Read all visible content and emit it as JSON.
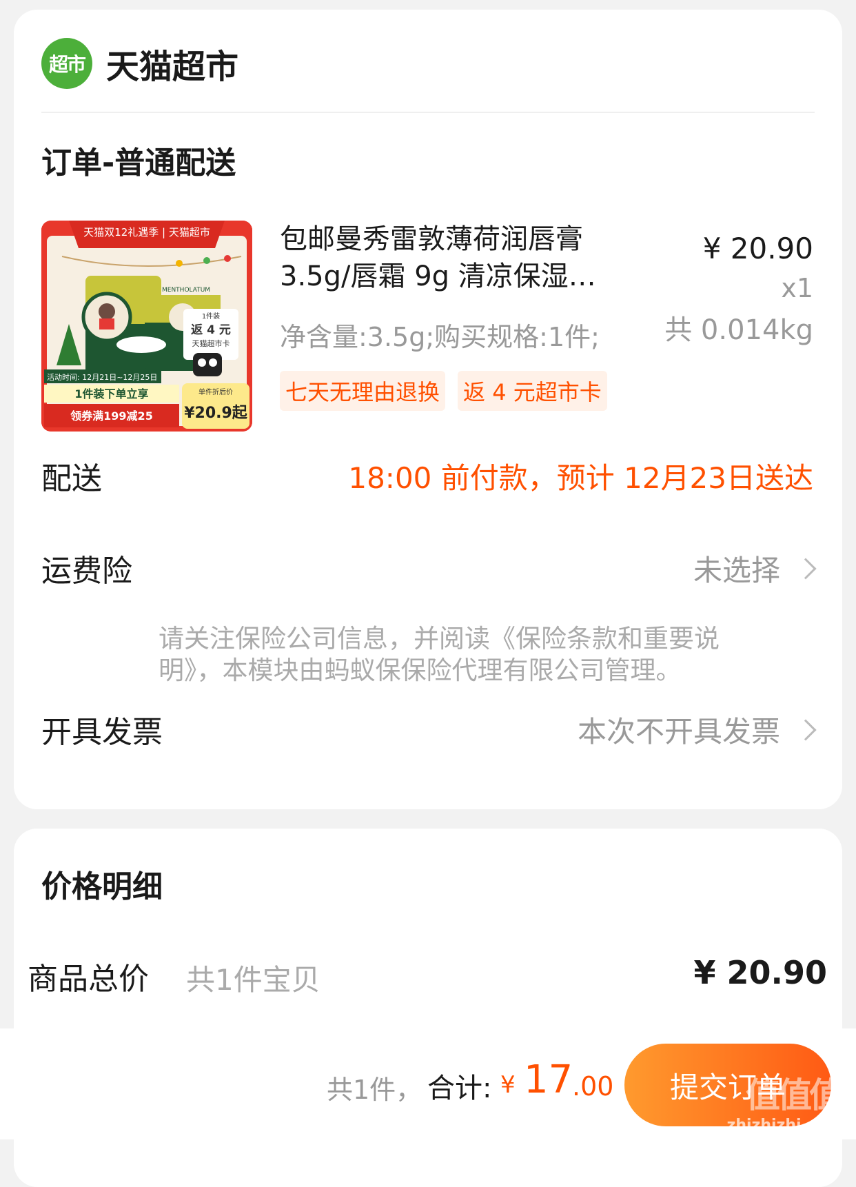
{
  "store": {
    "logo_text": "超市",
    "name": "天猫超市"
  },
  "order": {
    "section_title": "订单-普通配送",
    "product": {
      "title_line1": "包邮曼秀雷敦薄荷润唇膏",
      "title_line2": "3.5g/唇霜 9g 清凉保湿…",
      "spec": "净含量:3.5g;购买规格:1件;",
      "price": "¥ 20.90",
      "qty": "x1",
      "weight": "共 0.014kg",
      "tags": [
        "七天无理由退换",
        "返 4 元超市卡"
      ],
      "thumbnail": {
        "banner": "天猫双12礼遇季 | 天猫超市",
        "brand": "MENTHOLATUM",
        "promo_pack": "1件装",
        "promo_return": "返 4 元",
        "promo_card": "天猫超市卡",
        "activity_time": "活动时间: 12月21日~12月25日",
        "promo_line1": "1件装下单立享",
        "promo_line2": "领券满199减25",
        "after_price_label": "单件折后价",
        "after_price": "¥20.9起"
      }
    },
    "delivery": {
      "label": "配送",
      "value": "18:00 前付款，预计 12月23日送达"
    },
    "insurance": {
      "label": "运费险",
      "value": "未选择",
      "note": "请关注保险公司信息，并阅读《保险条款和重要说明》，本模块由蚂蚁保保险代理有限公司管理。"
    },
    "invoice": {
      "label": "开具发票",
      "value": "本次不开具发票"
    }
  },
  "price_detail": {
    "title": "价格明细",
    "goods_total_label": "商品总价",
    "goods_total_sub": "共1件宝贝",
    "goods_total_value": "¥ 20.90"
  },
  "bottom_bar": {
    "count": "共1件，",
    "total_label": "合计:",
    "currency": "¥",
    "amount_int": "17",
    "amount_dec": ".00",
    "submit_label": "提交订单"
  },
  "watermark": {
    "text": "值值值",
    "domain": "zhizhizhi.com"
  },
  "colors": {
    "accent": "#ff5000",
    "brand_green": "#4caf3a",
    "card_bg": "#ffffff",
    "page_bg": "#f2f2f2"
  },
  "icons": {
    "chevron": "chevron-right-icon"
  }
}
